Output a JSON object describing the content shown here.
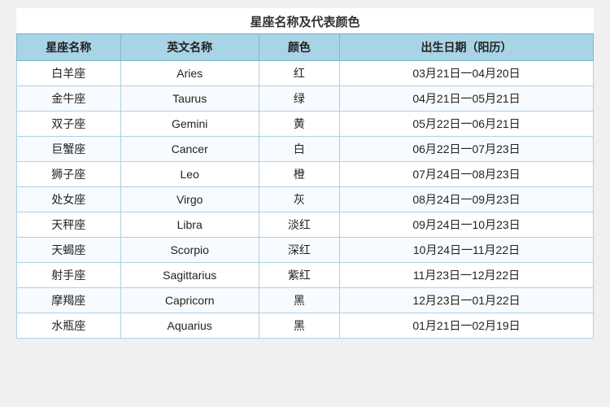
{
  "page": {
    "title": "星座名称及代表颜色"
  },
  "table": {
    "headers": [
      "星座名称",
      "英文名称",
      "颜色",
      "出生日期（阳历）"
    ],
    "rows": [
      {
        "zh": "白羊座",
        "en": "Aries",
        "color": "红",
        "date": "03月21日一04月20日"
      },
      {
        "zh": "金牛座",
        "en": "Taurus",
        "color": "绿",
        "date": "04月21日一05月21日"
      },
      {
        "zh": "双子座",
        "en": "Gemini",
        "color": "黄",
        "date": "05月22日一06月21日"
      },
      {
        "zh": "巨蟹座",
        "en": "Cancer",
        "color": "白",
        "date": "06月22日一07月23日"
      },
      {
        "zh": "狮子座",
        "en": "Leo",
        "color": "橙",
        "date": "07月24日一08月23日"
      },
      {
        "zh": "处女座",
        "en": "Virgo",
        "color": "灰",
        "date": "08月24日一09月23日"
      },
      {
        "zh": "天秤座",
        "en": "Libra",
        "color": "淡红",
        "date": "09月24日一10月23日"
      },
      {
        "zh": "天蝎座",
        "en": "Scorpio",
        "color": "深红",
        "date": "10月24日一11月22日"
      },
      {
        "zh": "射手座",
        "en": "Sagittarius",
        "color": "紫红",
        "date": "11月23日一12月22日"
      },
      {
        "zh": "摩羯座",
        "en": "Capricorn",
        "color": "黑",
        "date": "12月23日一01月22日"
      },
      {
        "zh": "水瓶座",
        "en": "Aquarius",
        "color": "黑",
        "date": "01月21日一02月19日"
      }
    ]
  }
}
